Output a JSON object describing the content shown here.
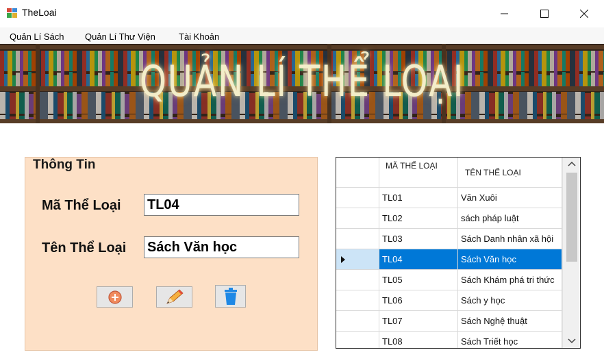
{
  "window": {
    "title": "TheLoai",
    "icon": "app-window-icon"
  },
  "menu": {
    "items": [
      "Quản Lí Sách",
      "Quản Lí Thư Viện",
      "Tài Khoản"
    ]
  },
  "banner": {
    "title": "QUẢN LÍ THỂ LOẠI"
  },
  "info_panel": {
    "legend": "Thông Tin",
    "ma_label": "Mã Thể Loại",
    "ma_value": "TL04",
    "ten_label": "Tên Thể Loại",
    "ten_value": "Sách Văn học",
    "buttons": [
      "add-icon",
      "edit-pencil-icon",
      "trash-icon"
    ]
  },
  "grid": {
    "headers": [
      "MÃ THỂ LOẠI",
      "TÊN THỂ LOẠI"
    ],
    "rows": [
      {
        "ma": "TL01",
        "ten": "Văn Xuôi"
      },
      {
        "ma": "TL02",
        "ten": "sách pháp luật"
      },
      {
        "ma": "TL03",
        "ten": "Sách Danh nhân xã hội"
      },
      {
        "ma": "TL04",
        "ten": "Sách Văn học"
      },
      {
        "ma": "TL05",
        "ten": "Sách Khám phá tri thức"
      },
      {
        "ma": "TL06",
        "ten": "Sách y học"
      },
      {
        "ma": "TL07",
        "ten": "Sách Nghệ thuật"
      },
      {
        "ma": "TL08",
        "ten": "Sách Triết học"
      }
    ],
    "selected_index": 3
  },
  "colors": {
    "panel_bg": "#fde0c6",
    "selection": "#0078d7"
  }
}
